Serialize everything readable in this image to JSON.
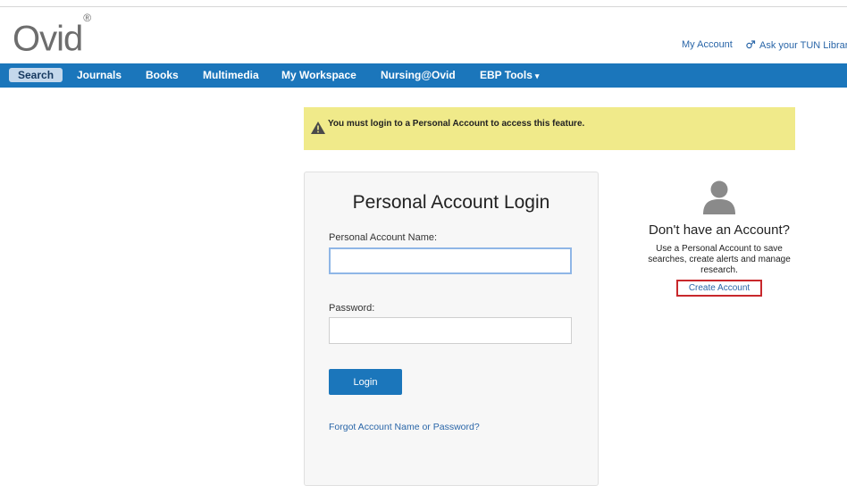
{
  "header": {
    "logo": "Ovid",
    "logo_mark": "®",
    "my_account": "My Account",
    "ask_librarian": "Ask your TUN Librarian",
    "ask_icon": "chat-bubbles-icon"
  },
  "nav": {
    "items": [
      {
        "label": "Search",
        "active": true
      },
      {
        "label": "Journals"
      },
      {
        "label": "Books"
      },
      {
        "label": "Multimedia"
      },
      {
        "label": "My Workspace"
      },
      {
        "label": "Nursing@Ovid"
      },
      {
        "label": "EBP Tools"
      }
    ],
    "dropdown_caret": "▾",
    "bar_color": "#1b76bb"
  },
  "alert": {
    "icon": "warning-icon",
    "message": "You must login to a Personal Account to access this feature.",
    "background": "#f0ea8a"
  },
  "login": {
    "title": "Personal Account Login",
    "name_label": "Personal Account Name:",
    "name_value": "",
    "password_label": "Password:",
    "password_value": "",
    "button_label": "Login",
    "forgot_link": "Forgot Account Name or Password?"
  },
  "signup": {
    "icon": "user-avatar-icon",
    "heading": "Don't have an Account?",
    "description": "Use a Personal Account to save searches, create alerts and manage research.",
    "create_link": "Create Account",
    "highlight_color": "#c8282c"
  }
}
